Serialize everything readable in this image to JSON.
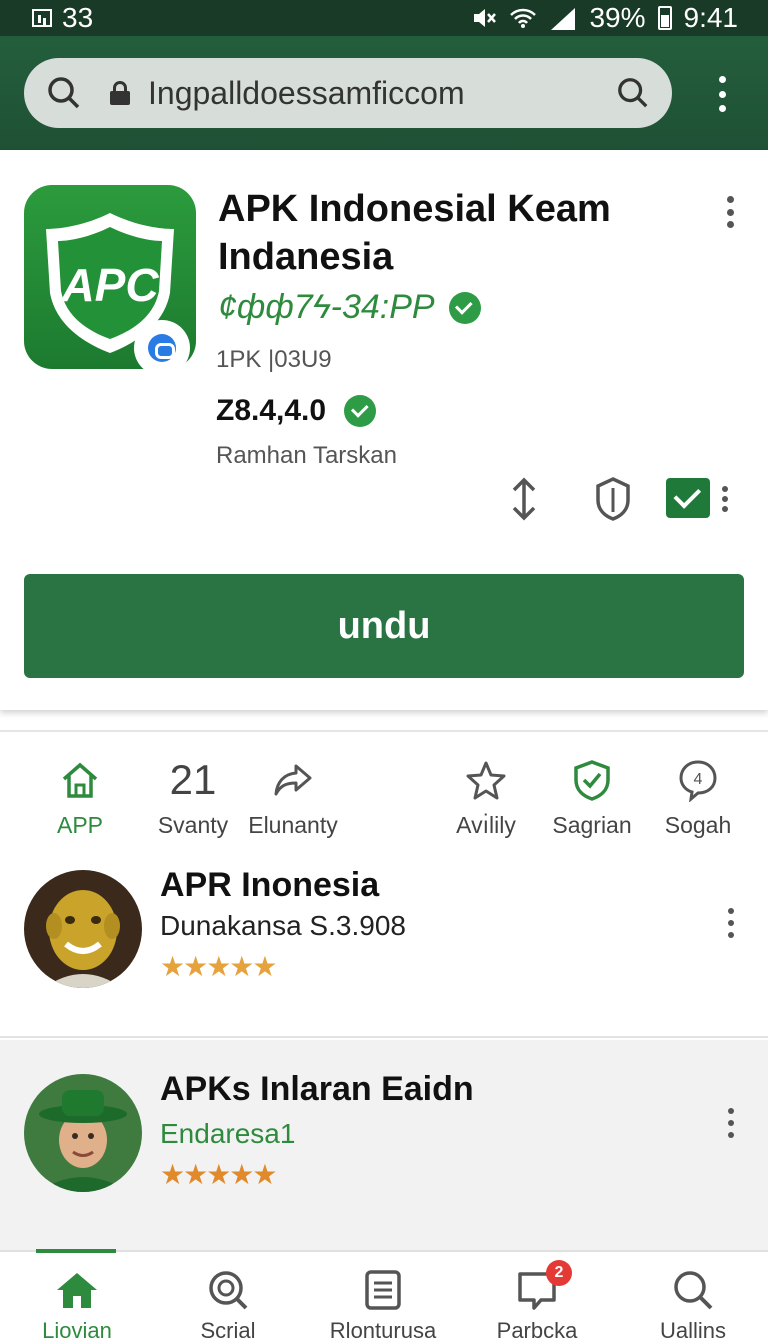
{
  "status_bar": {
    "notif_count": "33",
    "battery": "39%",
    "time": "9:41"
  },
  "browser": {
    "url": "Ingpalldoessamficcom"
  },
  "app": {
    "title": "APK Indonesial Keam Indanesia",
    "icon_text": "APC",
    "developer": "¢фф7ϟ-34:PP",
    "size": "1PK |03U9",
    "version": "Z8.4,4.0",
    "tag": "Ramhan Tarskan",
    "download_label": "undu",
    "brand_color": "#2a7444"
  },
  "categories": [
    {
      "icon": "home-icon",
      "label": "APP",
      "active": true
    },
    {
      "number": "21",
      "label": "Svanty"
    },
    {
      "icon": "share-icon",
      "label": "Elunanty"
    },
    {
      "icon": "star-icon",
      "label": "Avı̇lily"
    },
    {
      "icon": "shield-check-icon",
      "label": "Sagrian"
    },
    {
      "icon": "chat-bubble-icon",
      "label": "Sogah"
    }
  ],
  "list": [
    {
      "title": "APR Inonesia",
      "subtitle": "Dunakansa S.3.908",
      "stars": "★★★★★",
      "avatar": "avatar-yellow-face"
    },
    {
      "title": "APKs Inlaran Eaidn",
      "subtitle": "Endaresa1",
      "stars": "★★★★★",
      "avatar": "avatar-green-hat"
    }
  ],
  "bottom_nav": [
    {
      "icon": "home-icon",
      "label": "Liovian",
      "active": true
    },
    {
      "icon": "search-icon",
      "label": "Scrial"
    },
    {
      "icon": "document-icon",
      "label": "Rlonturusa"
    },
    {
      "icon": "chat-icon",
      "label": "Parbcka",
      "badge": "2"
    },
    {
      "icon": "search-icon",
      "label": "Uallins"
    }
  ]
}
